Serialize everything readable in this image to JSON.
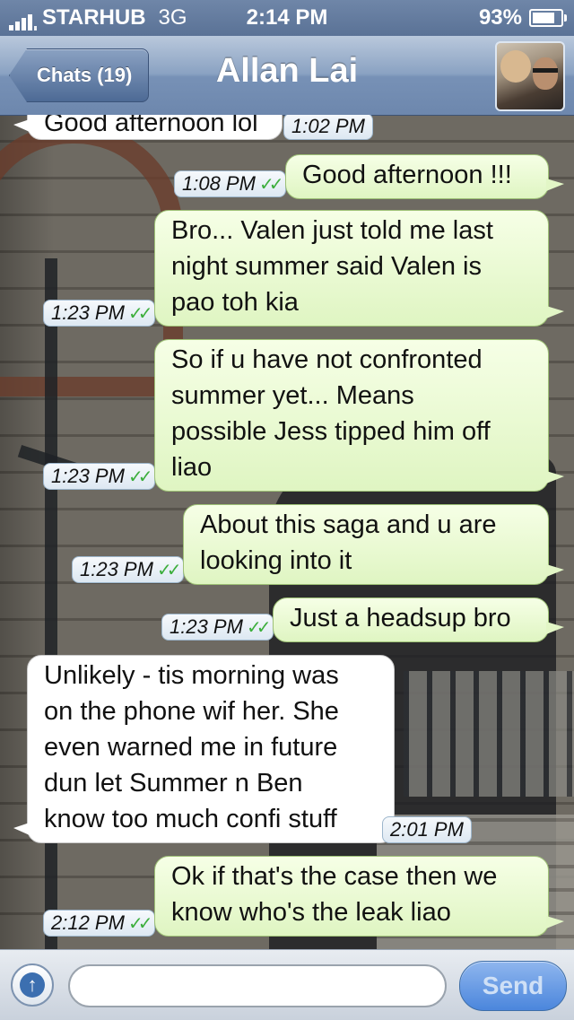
{
  "status_bar": {
    "carrier": "STARHUB",
    "network": "3G",
    "time": "2:14 PM",
    "battery": "93%",
    "battery_level": 0.93
  },
  "nav": {
    "back_label": "Chats (19)",
    "title": "Allan Lai"
  },
  "messages": [
    {
      "dir": "in",
      "text": "Good afternoon lol",
      "time": "1:02 PM",
      "read": false
    },
    {
      "dir": "out",
      "text": "Good afternoon !!!",
      "time": "1:08 PM",
      "read": true
    },
    {
      "dir": "out",
      "lines": [
        "Bro... Valen just told me last",
        "night summer said Valen is",
        "pao toh kia"
      ],
      "time": "1:23 PM",
      "read": true
    },
    {
      "dir": "out",
      "lines": [
        "So if u have not confronted",
        "summer yet... Means",
        "possible Jess tipped him off",
        "liao"
      ],
      "time": "1:23 PM",
      "read": true
    },
    {
      "dir": "out",
      "lines": [
        "About this saga and u are",
        "looking into it"
      ],
      "time": "1:23 PM",
      "read": true
    },
    {
      "dir": "out",
      "text": "Just a headsup bro",
      "time": "1:23 PM",
      "read": true
    },
    {
      "dir": "in",
      "lines": [
        "Unlikely - tis morning was",
        "on the phone wif her. She",
        "even warned me in future",
        "dun let Summer n Ben",
        "know too much confi stuff"
      ],
      "time": "2:01 PM",
      "read": false
    },
    {
      "dir": "out",
      "lines": [
        "Ok if that's the case then we",
        "know who's the leak liao"
      ],
      "time": "2:12 PM",
      "read": true
    }
  ],
  "composer": {
    "placeholder": "",
    "send_label": "Send"
  },
  "colors": {
    "outgoing_bubble": "#dff5c2",
    "incoming_bubble": "#ffffff",
    "read_ticks": "#3cae3c",
    "nav_bar": "#7791b6"
  },
  "icons": {
    "attach": "upload-arrow-icon",
    "read": "double-check-icon",
    "signal": "signal-bars-icon",
    "battery": "battery-icon"
  }
}
